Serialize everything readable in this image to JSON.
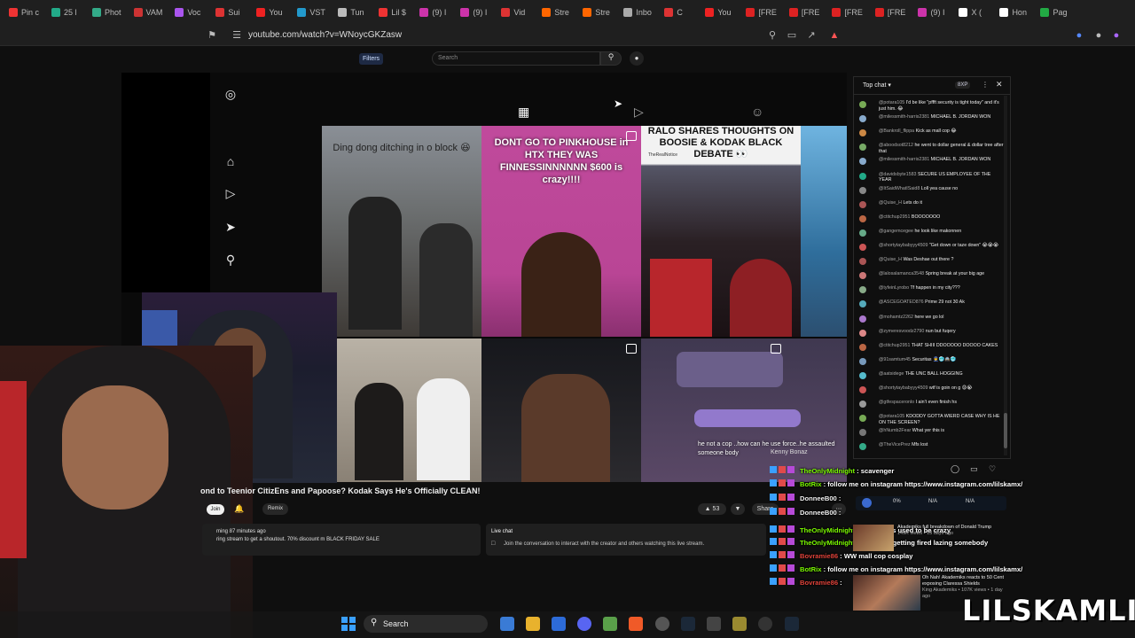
{
  "browser": {
    "tabs": [
      "Pin c",
      "25 l",
      "Phot",
      "VAM",
      "Voc",
      "Sui",
      "You",
      "VST",
      "Tun",
      "Lil $",
      "(9) I",
      "(9) I",
      "Vid",
      "Stre",
      "Stre",
      "Inbo",
      "C",
      "You",
      "[FRE",
      "[FRE",
      "[FRE",
      "[FRE",
      "(9) I",
      "X (",
      "Hon",
      "Pag"
    ],
    "url": "youtube.com/watch?v=WNoycGKZasw"
  },
  "youtube": {
    "filters": "Filters",
    "search_placeholder": "Search"
  },
  "video": {
    "tiles": [
      {
        "caption": "Ding dong ditching in o block 😆"
      },
      {
        "caption": "DONT GO TO PINKHOUSE in HTX THEY WAS FINNESSINNNNNN $600 is crazy!!!!"
      },
      {
        "caption": "RALO SHARES THOUGHTS ON BOOSIE & KODAK BLACK DEBATE 👀"
      },
      {
        "caption": ""
      },
      {
        "caption": ""
      },
      {
        "caption": "he not a cop ..how can he use force..he assaulted someone body"
      }
    ],
    "tile3_watermark": "TheRealNotice",
    "tile6_user": "Kenny Bonaz",
    "title": "ond to Teenior CitizEns and Papoose? Kodak Says He's Officially CLEAN!",
    "join": "Join",
    "remix": "Remix",
    "like_count": "53",
    "share": "Share",
    "desc_line1": "ming 87 minutes ago",
    "desc_line2": "ring stream to get a shoutout. 70% discount m BLACK FRIDAY SALE",
    "live_chat_title": "Live chat",
    "live_chat_msg": "Join the conversation to interact with the creator and others watching this live stream."
  },
  "top_chat": {
    "title": "Top chat",
    "badge": "8XP",
    "messages": [
      {
        "user": "@potara105",
        "text": "I'd be like \"pffft security is tight today\" and it's just him. 😂",
        "color": "#7a5"
      },
      {
        "user": "@milessmith-harris2381",
        "text": "MICHAEL B. JORDAN WON",
        "color": "#8ac"
      },
      {
        "user": "@Bankroll_flippa",
        "text": "Kick as mall cop 😂",
        "color": "#c84"
      },
      {
        "user": "@aboodsot8212",
        "text": "he went to dollar general & dollar tree after that",
        "color": "#7a6"
      },
      {
        "user": "@milessmith-harris2381",
        "text": "MICHAEL B. JORDAN WON",
        "color": "#8ac"
      },
      {
        "user": "@davidsbyte1583",
        "text": "SECURE US EMPLOYEE OF THE YEAR",
        "color": "#2a8"
      },
      {
        "user": "@ItSaidWhatISaid8",
        "text": "Loll yea cause no",
        "color": "#888"
      },
      {
        "user": "@Quise_H",
        "text": "Lets do it",
        "color": "#a55"
      },
      {
        "user": "@ctitchup2951",
        "text": "BOOOOOOO",
        "color": "#b64"
      },
      {
        "user": "@gangemcegee",
        "text": "he look like makonnen",
        "color": "#6a8"
      },
      {
        "user": "@shortytaybabyyy4509",
        "text": "\"Get down or taze down\" 😭😭😭",
        "color": "#c55"
      },
      {
        "user": "@Quise_H",
        "text": "Was Deshae out there ?",
        "color": "#a55"
      },
      {
        "user": "@lalosalamanca3548",
        "text": "Spring break at your big age",
        "color": "#c77"
      },
      {
        "user": "@tyfeinLyrobo",
        "text": "Tf happen in my city???",
        "color": "#8a8"
      },
      {
        "user": "@ASCEGOATED876",
        "text": "Prime 29 not 30 Ak",
        "color": "#5ab"
      },
      {
        "user": "@mohamtz2262",
        "text": "here we go lol",
        "color": "#a7c"
      },
      {
        "user": "@zymeresvoodz2790",
        "text": "nun but fuqery",
        "color": "#d88"
      },
      {
        "user": "@ctitchup2951",
        "text": "THAT SHIII DDOOOOO DOOOO CAKES",
        "color": "#b64"
      },
      {
        "user": "@91samtum45",
        "text": "Securitas 👮🥶🚔🥶",
        "color": "#79b"
      },
      {
        "user": "@aatsidege",
        "text": "THE UNC BALL HOGGING",
        "color": "#5bc"
      },
      {
        "user": "@shortytaybabyyy4509",
        "text": "wtf is goin on g 😩😭",
        "color": "#c55"
      },
      {
        "user": "@gtfespaceronlo",
        "text": "I ain't even finish hs",
        "color": "#999"
      },
      {
        "user": "@potara105",
        "text": "KDODDY GOTTA WIERD CASE WHY IS HE ON THE SCREEN?",
        "color": "#7a5"
      },
      {
        "user": "@hNumb2Fear",
        "text": "What yer this is",
        "color": "#777"
      },
      {
        "user": "@TheVicePrez",
        "text": "Mfs lost",
        "color": "#3a8"
      }
    ]
  },
  "overlay_chat": [
    {
      "user": "TheOnlyMidnight",
      "text": "scavenger",
      "ucolor": "#7CFC00"
    },
    {
      "user": "BotRix",
      "text": "follow me on instagram https://www.instagram.com/lilskamx/",
      "ucolor": "#7CFC00"
    },
    {
      "user": "DonneeB00",
      "text": "",
      "ucolor": "#eeeeee"
    },
    {
      "user": "DonneeB00",
      "text": "",
      "ucolor": "#eeeeee"
    },
    {
      "user": "TheOnlyMidnight",
      "text": "this videos used to be crazy",
      "ucolor": "#7CFC00"
    },
    {
      "user": "TheOnlyMidnight",
      "text": "ended up getting fired lazing somebody",
      "ucolor": "#7CFC00"
    },
    {
      "user": "Bovramie86",
      "text": "WW mall cop cosplay",
      "ucolor": "#e0433a"
    },
    {
      "user": "BotRix",
      "text": "follow me on instagram https://www.instagram.com/lilskamx/",
      "ucolor": "#7CFC00"
    },
    {
      "user": "Bovramie86",
      "text": "",
      "ucolor": "#e0433a"
    }
  ],
  "stats": [
    "0%",
    "N/A",
    "N/A"
  ],
  "recommend": [
    {
      "title": "Akademiks full breakdown of Donald Trump",
      "meta": "149K views • 13 days ago"
    },
    {
      "title": "Oh Nah! Akademiks reacts to 50 Cent exposing Claressa Shields",
      "meta": "King Akademiks • 107K views • 1 day ago"
    }
  ],
  "taskbar": {
    "search": "Search"
  },
  "watermark": "LILSKAMLIVE"
}
